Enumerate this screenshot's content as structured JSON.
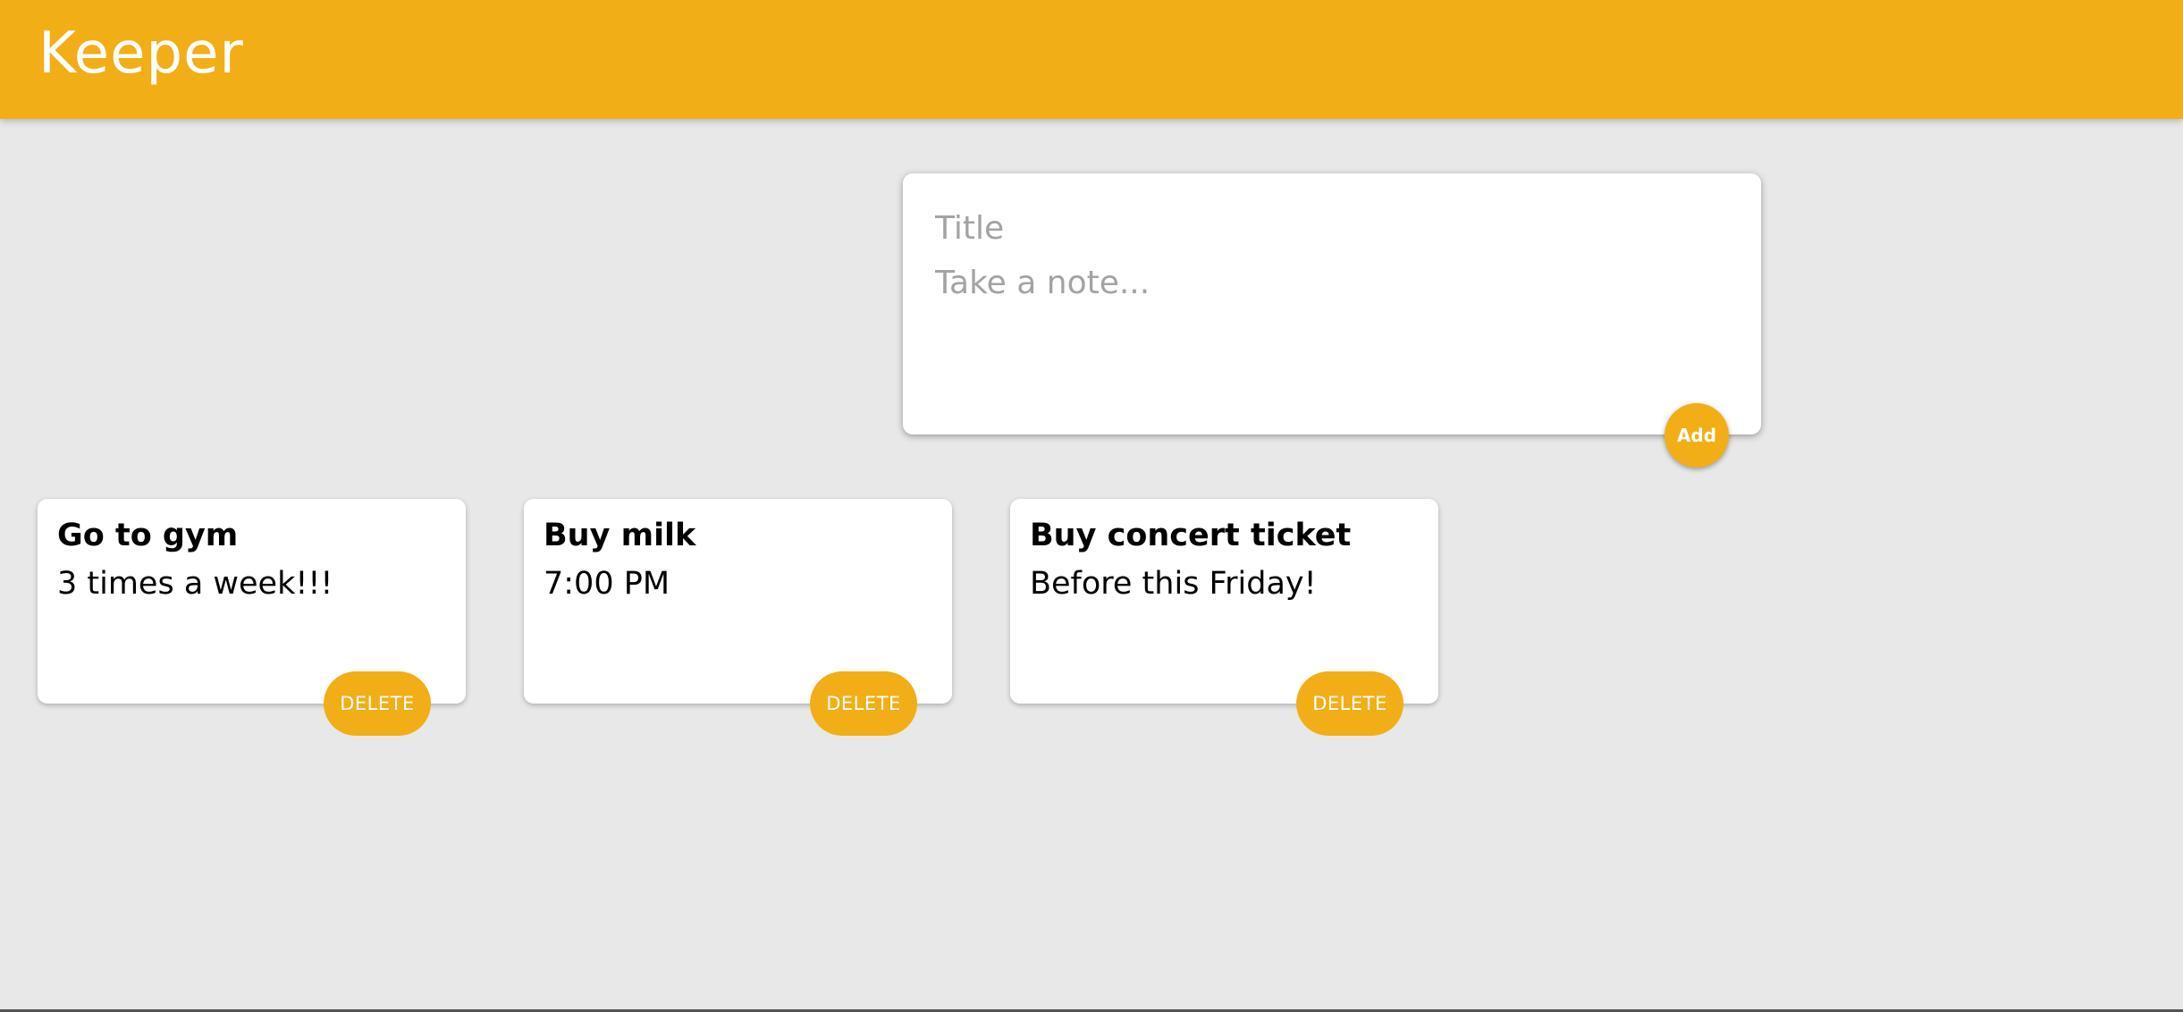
{
  "header": {
    "brand": "Keeper"
  },
  "composer": {
    "title_placeholder": "Title",
    "note_placeholder": "Take a note...",
    "add_label": "Add"
  },
  "notes": [
    {
      "title": "Go to gym",
      "content": "3 times a week!!!",
      "delete_label": "DELETE"
    },
    {
      "title": "Buy milk",
      "content": "7:00 PM",
      "delete_label": "DELETE"
    },
    {
      "title": "Buy concert ticket",
      "content": "Before this Friday!",
      "delete_label": "DELETE"
    }
  ],
  "colors": {
    "accent": "#f2ae17",
    "background": "#e8e8e8",
    "card": "#ffffff"
  }
}
